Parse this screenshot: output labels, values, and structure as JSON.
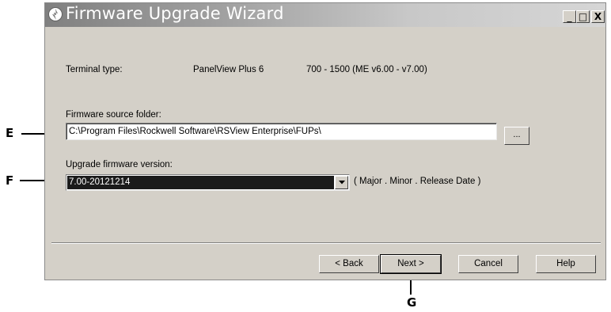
{
  "window": {
    "title": "Firmware Upgrade Wizard",
    "controls": {
      "minimize": "_",
      "maximize": "□",
      "close": "X"
    }
  },
  "terminal": {
    "label": "Terminal type:",
    "model": "PanelView Plus 6",
    "range": "700 - 1500  (ME v6.00 - v7.00)"
  },
  "source": {
    "label": "Firmware source folder:",
    "value": "C:\\Program Files\\Rockwell Software\\RSView Enterprise\\FUPs\\",
    "browse_label": "..."
  },
  "version": {
    "label": "Upgrade firmware version:",
    "selected": "7.00-20121214",
    "hint": "( Major . Minor . Release Date )"
  },
  "buttons": {
    "back": "< Back",
    "next": "Next >",
    "cancel": "Cancel",
    "help": "Help"
  },
  "callouts": {
    "e": "E",
    "f": "F",
    "g": "G"
  },
  "icons": {
    "title": "wizard-icon",
    "dropdown": "chevron-down-icon"
  },
  "colors": {
    "window_bg": "#d4d0c8",
    "selection_bg": "#1b1b1b",
    "selection_text": "#ffffff"
  }
}
